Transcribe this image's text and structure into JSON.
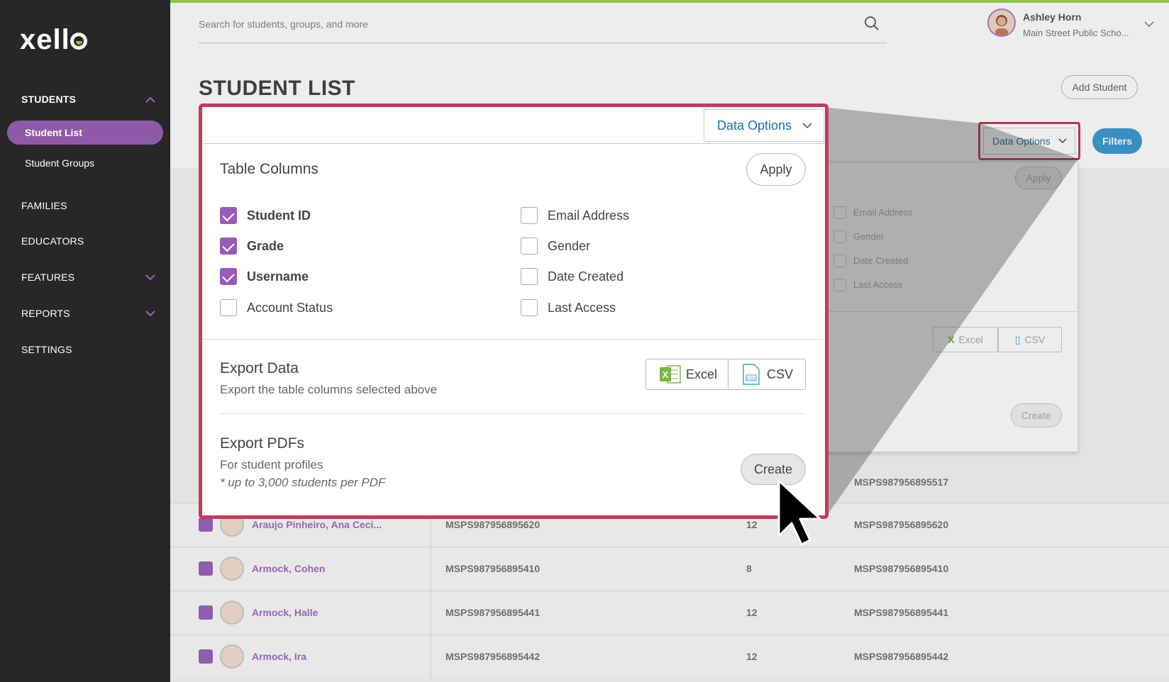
{
  "app": {
    "logo": "xello"
  },
  "sidebar": {
    "students": "STUDENTS",
    "student_list": "Student List",
    "student_groups": "Student Groups",
    "families": "FAMILIES",
    "educators": "EDUCATORS",
    "features": "FEATURES",
    "reports": "REPORTS",
    "settings": "SETTINGS"
  },
  "header": {
    "search_placeholder": "Search for students, groups, and more",
    "user_name": "Ashley Horn",
    "user_school": "Main Street Public Scho..."
  },
  "page": {
    "title": "STUDENT LIST",
    "add_student": "Add Student",
    "data_options": "Data Options",
    "filters": "Filters"
  },
  "popup": {
    "data_options": "Data Options",
    "table_columns_title": "Table Columns",
    "apply": "Apply",
    "columns": [
      {
        "label": "Student ID",
        "checked": true
      },
      {
        "label": "Grade",
        "checked": true
      },
      {
        "label": "Username",
        "checked": true
      },
      {
        "label": "Account Status",
        "checked": false
      },
      {
        "label": "Email Address",
        "checked": false
      },
      {
        "label": "Gender",
        "checked": false
      },
      {
        "label": "Date Created",
        "checked": false
      },
      {
        "label": "Last Access",
        "checked": false
      }
    ],
    "export_data_title": "Export Data",
    "export_data_sub": "Export the table columns selected above",
    "excel": "Excel",
    "csv": "CSV",
    "export_pdfs_title": "Export PDFs",
    "export_pdfs_sub": "For student profiles",
    "export_pdfs_note": "* up to 3,000 students per PDF",
    "create": "Create"
  },
  "mini_popup": {
    "apply": "Apply",
    "email": "Email Address",
    "gender": "Gender",
    "date_created": "Date Created",
    "last_access": "Last Access",
    "excel": "Excel",
    "csv": "CSV",
    "create": "Create"
  },
  "partial_username": "MSPS987956895517",
  "rows": [
    {
      "name": "Araujo Pinheiro, Ana Ceci...",
      "id": "MSPS987956895620",
      "grade": "12",
      "username": "MSPS987956895620"
    },
    {
      "name": "Armock, Cohen",
      "id": "MSPS987956895410",
      "grade": "8",
      "username": "MSPS987956895410"
    },
    {
      "name": "Armock, Halle",
      "id": "MSPS987956895441",
      "grade": "12",
      "username": "MSPS987956895441"
    },
    {
      "name": "Armock, Ira",
      "id": "MSPS987956895442",
      "grade": "12",
      "username": "MSPS987956895442"
    }
  ],
  "colors": {
    "accent": "#9a5ab8",
    "highlight": "#c8395b",
    "link": "#1a6fa3",
    "filters": "#3e9ad1",
    "brand_green": "#8fc34a"
  }
}
